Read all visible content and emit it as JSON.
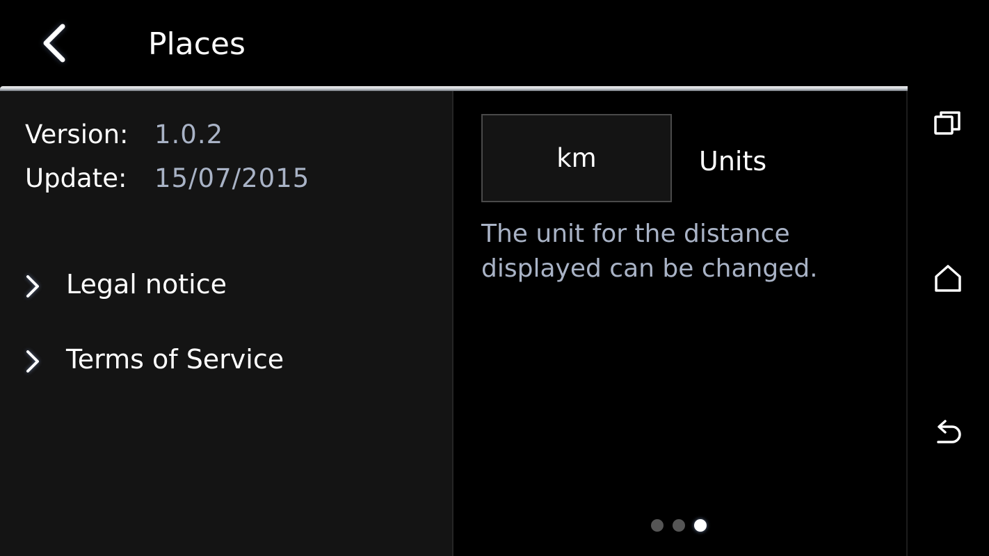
{
  "header": {
    "title": "Places",
    "back_icon": "chevron-left-icon"
  },
  "info": {
    "version_label": "Version:",
    "version_value": "1.0.2",
    "update_label": "Update:",
    "update_value": "15/07/2015"
  },
  "links": [
    {
      "label": "Legal notice",
      "icon": "chevron-right-icon"
    },
    {
      "label": "Terms of Service",
      "icon": "chevron-right-icon"
    }
  ],
  "units": {
    "selected_value": "km",
    "label": "Units",
    "description": "The unit for the distance displayed can be changed."
  },
  "pagination": {
    "count": 3,
    "active_index": 2
  },
  "navbar": {
    "icons": [
      "recents-icon",
      "home-icon",
      "back-icon"
    ]
  },
  "colors": {
    "background": "#000000",
    "panel": "#141414",
    "secondary_text": "#a9b3c6",
    "glow": "#a0beff"
  }
}
